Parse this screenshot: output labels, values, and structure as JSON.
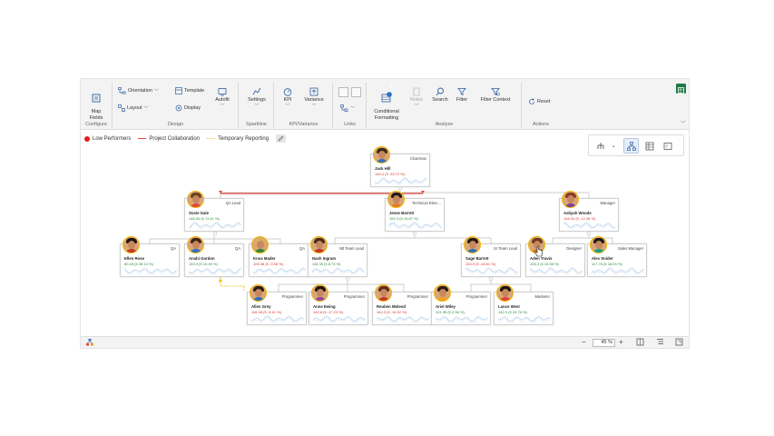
{
  "ribbon": {
    "configure": {
      "label": "Configure",
      "map_fields": "Map\nFields"
    },
    "design": {
      "label": "Design",
      "orientation": "Orientation",
      "template": "Template",
      "layout": "Layout",
      "display": "Display",
      "autofit": "Autofit"
    },
    "sparkline": {
      "label": "Sparkline",
      "settings": "Settings"
    },
    "kpi_variance": {
      "label": "KPI/Variance",
      "kpi": "KPI",
      "variance": "Variance"
    },
    "links": {
      "label": "Links"
    },
    "analyze": {
      "label": "Analyze",
      "conditional_formatting": "Conditional\nFormatting",
      "badge": "1",
      "notes": "Notes",
      "search": "Search",
      "filter": "Filter",
      "filter_context": "Filter Context"
    },
    "actions": {
      "label": "Actions",
      "reset": "Reset"
    }
  },
  "legend": {
    "items": [
      {
        "label": "Low Performers",
        "color": "#e02020"
      },
      {
        "label": "Project Collaboration",
        "color": "#e0443a"
      },
      {
        "label": "Temporary Reporting",
        "color": "#f0c020"
      }
    ]
  },
  "nodes": [
    {
      "name": "Jack Hill",
      "role": "Chairman",
      "kpi": "144.4 (5 -33.72 %)",
      "trend": "dn"
    },
    {
      "name": "Susie Gale",
      "role": "QA Lead",
      "kpi": "148.34 (5 11.41 %)",
      "trend": "up"
    },
    {
      "name": "Jesse Barrett",
      "role": "Technical Direc...",
      "kpi": "152.3 (5 15.87 %)",
      "trend": "up"
    },
    {
      "name": "Aaliyah Woods",
      "role": "Manager",
      "kpi": "148.34 (5 -12.38 %)",
      "trend": "dn"
    },
    {
      "name": "Ellen Rose",
      "role": "QA",
      "kpi": "80.45 (5 35.13 %)",
      "trend": "up"
    },
    {
      "name": "Anahi Gordon",
      "role": "QA",
      "kpi": "153.9 (5 10.49 %)",
      "trend": "up"
    },
    {
      "name": "Knox Mader",
      "role": "QA",
      "kpi": "105.38 (5 -9.08 %)",
      "trend": "dn"
    },
    {
      "name": "Nash Ingram",
      "role": "Ntl Team Lead",
      "kpi": "116.35 (5 8.73 %)",
      "trend": "up"
    },
    {
      "name": "Sage Barrett",
      "role": "Sr Team Lead",
      "kpi": "153.9 (5 -18.61 %)",
      "trend": "dn"
    },
    {
      "name": "Aden Travis",
      "role": "Designer",
      "kpi": "105.3 (5 15.38 %)",
      "trend": "up"
    },
    {
      "name": "Alex Snider",
      "role": "Sales Manager",
      "kpi": "117.78 (5 18.93 %)",
      "trend": "up"
    },
    {
      "name": "Allen Grey",
      "role": "Programmer",
      "kpi": "118.38 (5 -3.41 %)",
      "trend": "dn"
    },
    {
      "name": "Anne Ewing",
      "role": "Programmer",
      "kpi": "142.8 (5 -17.23 %)",
      "trend": "dn"
    },
    {
      "name": "Reuben Moleod",
      "role": "Programmer",
      "kpi": "142.3 (5 -16.92 %)",
      "trend": "dn"
    },
    {
      "name": "Ariel Wiley",
      "role": "Programmer",
      "kpi": "101.55 (5 2.96 %)",
      "trend": "up"
    },
    {
      "name": "Lance West",
      "role": "Marketer",
      "kpi": "142.9 (5 20.76 %)",
      "trend": "up"
    }
  ],
  "status": {
    "zoom": "45 %"
  }
}
